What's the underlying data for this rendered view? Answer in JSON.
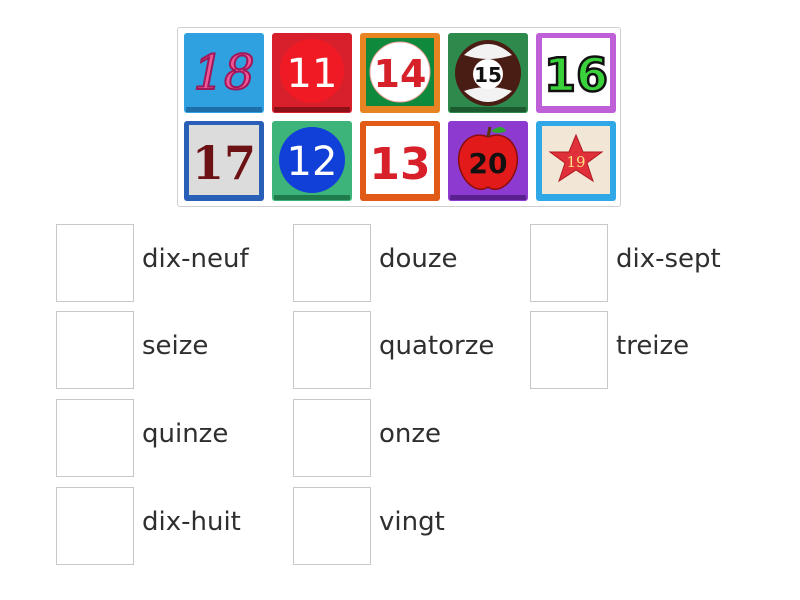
{
  "tiles": [
    {
      "number": "18",
      "style": "pink-italic-on-blue"
    },
    {
      "number": "11",
      "style": "white-on-red-circle"
    },
    {
      "number": "14",
      "style": "red-on-white-circle-green-frame"
    },
    {
      "number": "15",
      "style": "billiard-ball"
    },
    {
      "number": "16",
      "style": "green-on-white-purple-frame"
    },
    {
      "number": "17",
      "style": "dark-red-glitter"
    },
    {
      "number": "12",
      "style": "white-on-blue-circle"
    },
    {
      "number": "13",
      "style": "red-on-white-orange-frame"
    },
    {
      "number": "20",
      "style": "red-apple"
    },
    {
      "number": "19",
      "style": "felt-star"
    }
  ],
  "words": [
    {
      "label": "dix-neuf"
    },
    {
      "label": "douze"
    },
    {
      "label": "dix-sept"
    },
    {
      "label": "seize"
    },
    {
      "label": "quatorze"
    },
    {
      "label": "treize"
    },
    {
      "label": "quinze"
    },
    {
      "label": "onze"
    },
    {
      "label": "dix-huit"
    },
    {
      "label": "vingt"
    }
  ],
  "colors": {
    "drop_border": "#c8c8c8",
    "text": "#2f2f2f",
    "tray_border": "#cfcfcf"
  }
}
